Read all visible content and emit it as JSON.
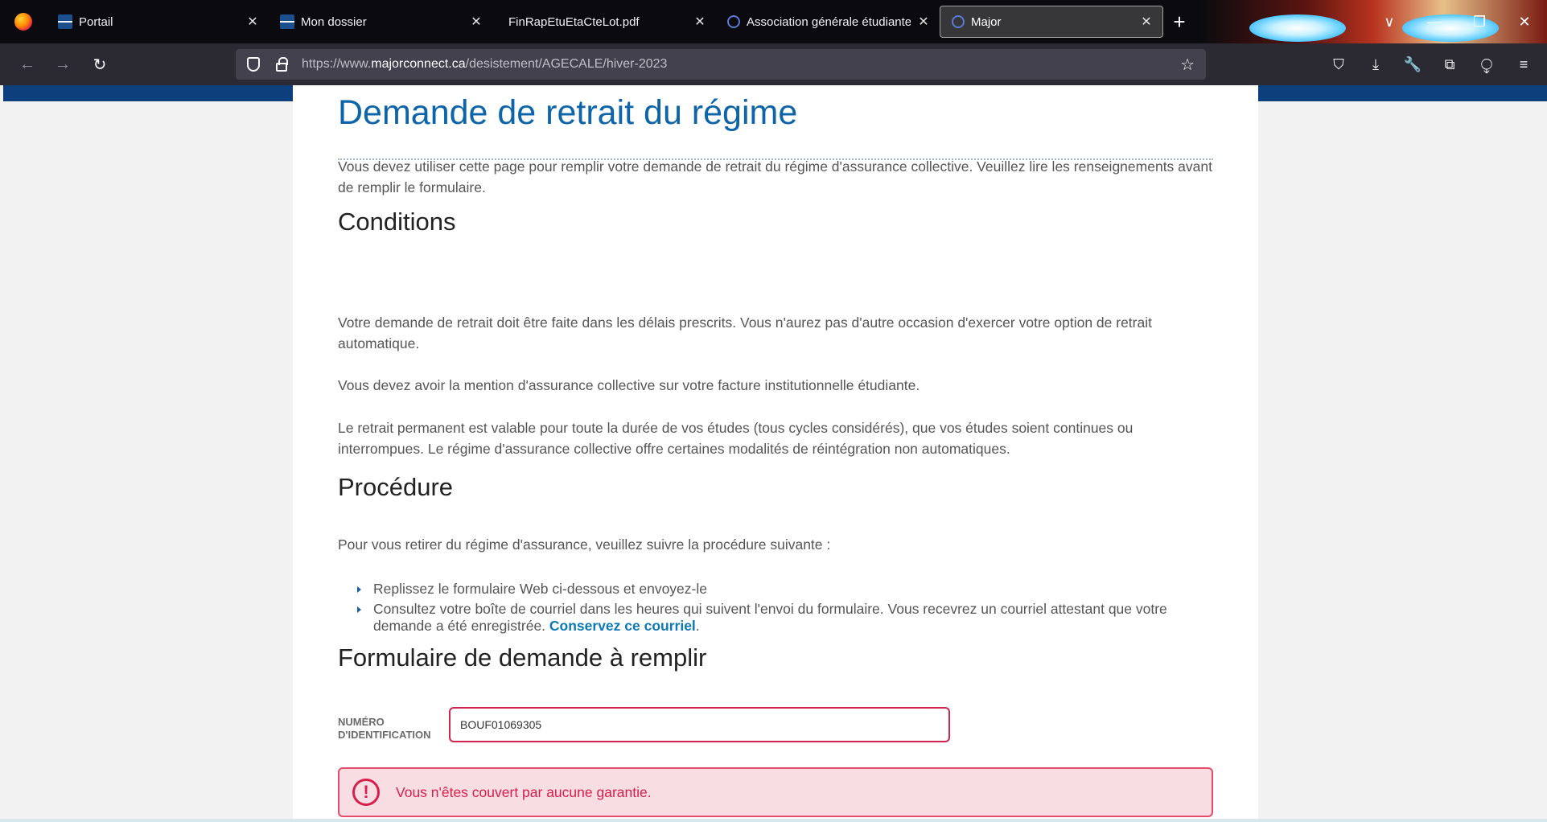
{
  "browser": {
    "tabs": [
      {
        "label": "Portail",
        "favicon": "portail-favicon",
        "active": false
      },
      {
        "label": "Mon dossier",
        "favicon": "portail-favicon",
        "active": false
      },
      {
        "label": "FinRapEtuEtaCteLot.pdf",
        "favicon": "none",
        "active": false
      },
      {
        "label": "Association générale étudiante",
        "favicon": "circle-favicon",
        "active": false
      },
      {
        "label": "Major",
        "favicon": "circle-favicon",
        "active": true
      }
    ],
    "tab_close": "✕",
    "new_tab": "+",
    "url_prefix": "https://www.",
    "url_domain": "majorconnect.ca",
    "url_path": "/desistement/AGECALE/hiver-2023",
    "icons": {
      "back": "←",
      "forward": "→",
      "reload": "↻",
      "star": "☆",
      "minimize": "—",
      "restore": "❐",
      "close": "✕",
      "pocket": "⛉",
      "download": "⤓",
      "tools": "🔧",
      "extension": "⧉",
      "puzzle": "⧬",
      "menu": "≡",
      "list_all": "∨"
    }
  },
  "page": {
    "title": "Demande de retrait du régime",
    "intro": "Vous devez utiliser cette page pour remplir votre demande de retrait du régime d'assurance collective. Veuillez lire les renseignements avant de remplir le formulaire.",
    "conditions_heading": "Conditions",
    "condition_1": "Votre demande de retrait doit être faite dans les délais prescrits. Vous n'aurez pas d'autre occasion d'exercer votre option de retrait automatique.",
    "condition_2": "Vous devez avoir la mention d'assurance collective sur votre facture institutionnelle étudiante.",
    "condition_3": "Le retrait permanent est valable pour toute la durée de vos études (tous cycles considérés), que vos études soient continues ou interrompues. Le régime d'assurance collective offre certaines modalités de réintégration non automatiques.",
    "procedure_heading": "Procédure",
    "procedure_intro": "Pour vous retirer du régime d'assurance, veuillez suivre la procédure suivante :",
    "step_1": "Replissez le formulaire Web ci-dessous et envoyez-le",
    "step_2": "Consultez votre boîte de courriel dans les heures qui suivent l'envoi du formulaire. Vous recevrez un courriel attestant que votre demande a été enregistrée. ",
    "step_2_emphasis": "Conservez ce courriel",
    "step_2_end": ".",
    "form_heading": "Formulaire de demande à remplir",
    "id_label_line1": "NUMÉRO",
    "id_label_line2": "D'IDENTIFICATION",
    "id_value": "BOUF01069305",
    "alert_icon": "!",
    "alert_text": "Vous n'êtes couvert par aucune garantie."
  },
  "colors": {
    "title_blue": "#0d64a8",
    "error_red": "#d81e4b",
    "alert_bg": "#f8dde2",
    "band_blue": "#0d3f7c"
  }
}
